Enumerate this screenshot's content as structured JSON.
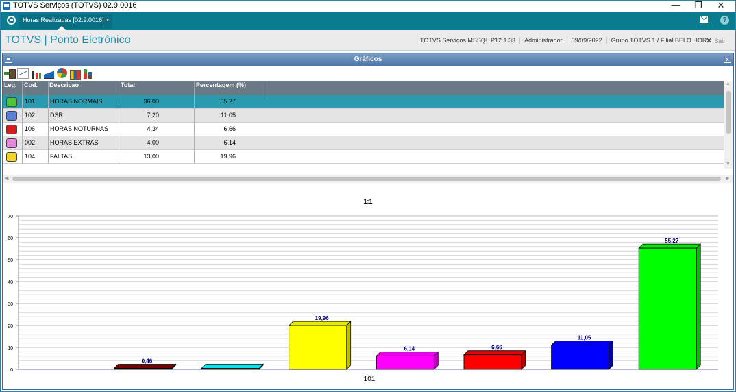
{
  "window": {
    "title": "TOTVS Serviços (TOTVS) 02.9.0016",
    "minimize": "—",
    "restore": "❐",
    "close": "✕"
  },
  "tabbar": {
    "tab_label": "Horas Realizadas [02.9.0016]",
    "tab_close": "×"
  },
  "header": {
    "brand": "TOTVS | Ponto Eletrônico",
    "environment": "TOTVS Serviços MSSQL P12.1.33",
    "user": "Administrador",
    "date": "09/09/2022",
    "company": "Grupo TOTVS 1 / Filial BELO HOR",
    "exit_icon": "✕",
    "exit_label": "Sair"
  },
  "dialog": {
    "title": "Gráficos",
    "close": "x"
  },
  "toolbar": [
    "exit-icon",
    "line-chart-icon",
    "bar-chart-icon",
    "area-chart-icon",
    "pie-chart-icon",
    "grouped-bar-icon",
    "stacked-bar-icon"
  ],
  "grid": {
    "columns": [
      "Leg.",
      "Cod.",
      "Descricao",
      "Total",
      "Percentagem (%)"
    ],
    "rows": [
      {
        "color": "#4fc43a",
        "code": "101",
        "desc": "HORAS NORMAIS",
        "total": "36,00",
        "pct": "55,27"
      },
      {
        "color": "#5b7fd6",
        "code": "102",
        "desc": "DSR",
        "total": "7,20",
        "pct": "11,05"
      },
      {
        "color": "#d31d1d",
        "code": "106",
        "desc": "HORAS NOTURNAS",
        "total": "4,34",
        "pct": "6,66"
      },
      {
        "color": "#e48ad8",
        "code": "002",
        "desc": "HORAS EXTRAS",
        "total": "4,00",
        "pct": "6,14"
      },
      {
        "color": "#f2d42a",
        "code": "104",
        "desc": "FALTAS",
        "total": "13,00",
        "pct": "19,96"
      }
    ]
  },
  "chart_data": {
    "type": "bar",
    "title": "1:1",
    "xlabel": "101",
    "ylim": [
      0,
      70
    ],
    "yticks": [
      0,
      10,
      20,
      30,
      40,
      50,
      60,
      70
    ],
    "grid": true,
    "series": [
      {
        "value": 0,
        "label": "",
        "color": "#ffffff"
      },
      {
        "value": 0.46,
        "label": "0,46",
        "color": "#8b0000"
      },
      {
        "value": 0,
        "label": "",
        "color": "#00ffff"
      },
      {
        "value": 19.96,
        "label": "19,96",
        "color": "#ffff00"
      },
      {
        "value": 6.14,
        "label": "6,14",
        "color": "#ff00ff"
      },
      {
        "value": 6.66,
        "label": "6,66",
        "color": "#ff0000"
      },
      {
        "value": 11.05,
        "label": "11,05",
        "color": "#0000ff"
      },
      {
        "value": 55.27,
        "label": "55,27",
        "color": "#00ff00"
      }
    ]
  }
}
